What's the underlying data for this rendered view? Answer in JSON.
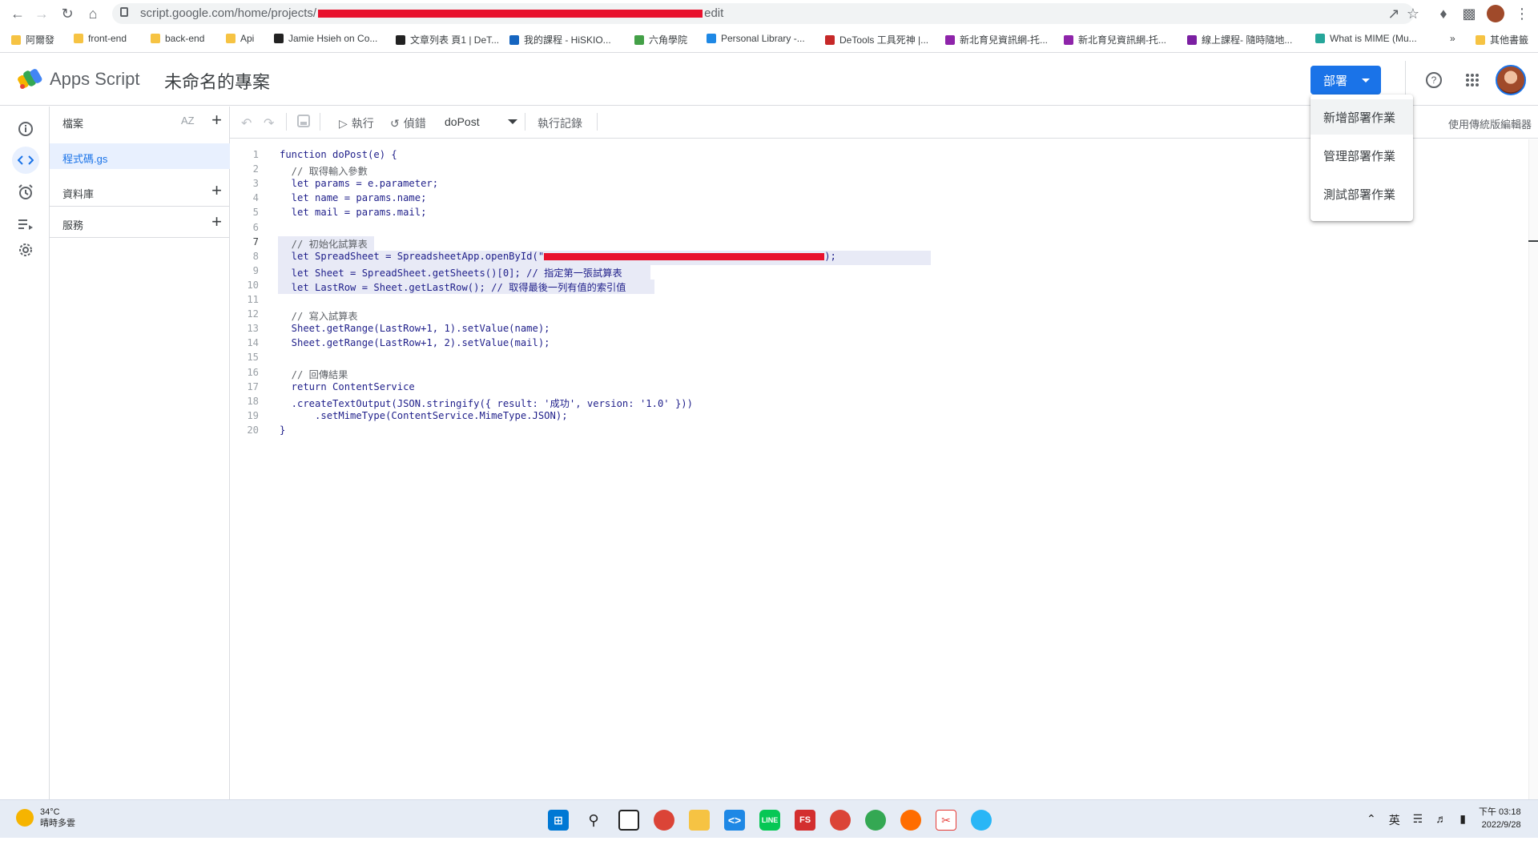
{
  "browser": {
    "url_prefix": "script.google.com/home/projects/",
    "url_suffix": "edit",
    "bookmarks": [
      "阿爾發",
      "front-end",
      "back-end",
      "Api",
      "Jamie Hsieh on Co...",
      "文章列表 頁1 | DeT...",
      "我的課程 - HiSKIO...",
      "六角學院",
      "Personal Library -...",
      "DeTools 工具死神 |...",
      "新北育兒資訊網-托...",
      "新北育兒資訊網-托...",
      "線上課程- 隨時隨地...",
      "What is MIME (Mu...",
      "»",
      "其他書籤"
    ]
  },
  "app": {
    "name": "Apps Script",
    "project_title": "未命名的專案",
    "deploy_label": "部署"
  },
  "deploy_menu": [
    "新增部署作業",
    "管理部署作業",
    "測試部署作業"
  ],
  "files_panel": {
    "title": "檔案",
    "sort_label": "AZ",
    "active_file": "程式碼.gs",
    "libraries_label": "資料庫",
    "services_label": "服務"
  },
  "toolbar": {
    "run_label": "執行",
    "debug_label": "偵錯",
    "function_name": "doPost",
    "log_label": "執行記錄",
    "legacy_editor": "使用傳統版編輯器"
  },
  "code_lines": [
    {
      "n": "1",
      "text": "function doPost(e) {"
    },
    {
      "n": "2",
      "text": "  // 取得輸入參數"
    },
    {
      "n": "3",
      "text": "  let params = e.parameter;"
    },
    {
      "n": "4",
      "text": "  let name = params.name;"
    },
    {
      "n": "5",
      "text": "  let mail = params.mail;"
    },
    {
      "n": "6",
      "text": ""
    },
    {
      "n": "7",
      "text": "  // 初始化試算表"
    },
    {
      "n": "8",
      "text": "  let SpreadSheet = SpreadsheetApp.openById(\""
    },
    {
      "n": "9",
      "text": "  let Sheet = SpreadSheet.getSheets()[0]; // 指定第一張試算表"
    },
    {
      "n": "10",
      "text": "  let LastRow = Sheet.getLastRow(); // 取得最後一列有值的索引值"
    },
    {
      "n": "11",
      "text": ""
    },
    {
      "n": "12",
      "text": "  // 寫入試算表"
    },
    {
      "n": "13",
      "text": "  Sheet.getRange(LastRow+1, 1).setValue(name);"
    },
    {
      "n": "14",
      "text": "  Sheet.getRange(LastRow+1, 2).setValue(mail);"
    },
    {
      "n": "15",
      "text": ""
    },
    {
      "n": "16",
      "text": "  // 回傳結果"
    },
    {
      "n": "17",
      "text": "  return ContentService"
    },
    {
      "n": "18",
      "text": "  .createTextOutput(JSON.stringify({ result: '成功', version: '1.0' }))"
    },
    {
      "n": "19",
      "text": "      .setMimeType(ContentService.MimeType.JSON);"
    },
    {
      "n": "20",
      "text": "}"
    }
  ],
  "code_line8_suffix": ");",
  "taskbar": {
    "temperature": "34°C",
    "weather": "晴時多雲",
    "ime": "英",
    "time": "下午 03:18",
    "date": "2022/9/28"
  },
  "colors": {
    "accent": "#1a73e8",
    "redaction": "#e8112d"
  }
}
